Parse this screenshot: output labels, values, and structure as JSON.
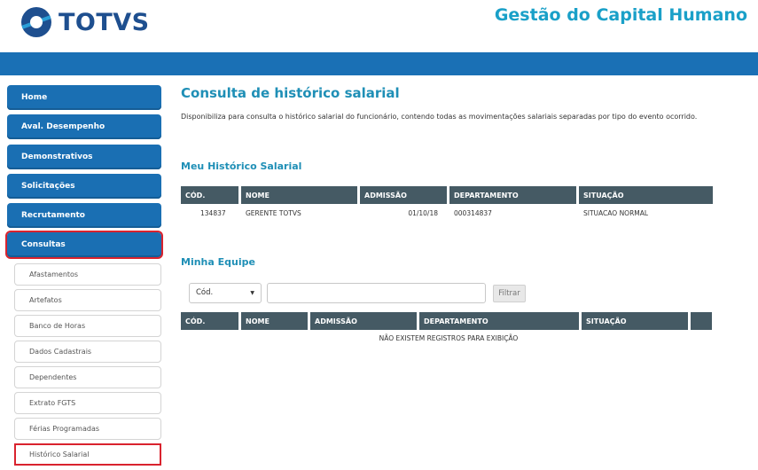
{
  "header": {
    "logo_text": "TOTVS",
    "app_title": "Gestão do Capital Humano"
  },
  "sidebar": {
    "main_items": [
      "Home",
      "Aval. Desempenho",
      "Demonstrativos",
      "Solicitações",
      "Recrutamento",
      "Consultas"
    ],
    "sub_items": [
      "Afastamentos",
      "Artefatos",
      "Banco de Horas",
      "Dados Cadastrais",
      "Dependentes",
      "Extrato FGTS",
      "Férias Programadas",
      "Histórico Salarial"
    ]
  },
  "page": {
    "title": "Consulta de histórico salarial",
    "description": "Disponibiliza para consulta o histórico salarial do funcionário, contendo todas as movimentações salariais separadas por tipo do evento ocorrido."
  },
  "my_history": {
    "title": "Meu Histórico Salarial",
    "headers": [
      "CÓD.",
      "NOME",
      "ADMISSÃO",
      "DEPARTAMENTO",
      "SITUAÇÃO"
    ],
    "row": {
      "cod": "134837",
      "nome": "GERENTE TOTVS",
      "admissao": "01/10/18",
      "departamento": "000314837",
      "situacao": "SITUACAO NORMAL"
    }
  },
  "team": {
    "title": "Minha Equipe",
    "filter_select": "Cód.",
    "filter_button": "Filtrar",
    "headers": [
      "CÓD.",
      "NOME",
      "ADMISSÃO",
      "DEPARTAMENTO",
      "SITUAÇÃO",
      ""
    ],
    "empty_message": "NÃO EXISTEM REGISTROS PARA EXIBIÇÃO"
  },
  "colors": {
    "brand_blue": "#1a70b5",
    "title_teal": "#1f8fb6",
    "table_header": "#455a64",
    "highlight_red": "#d9232e"
  }
}
